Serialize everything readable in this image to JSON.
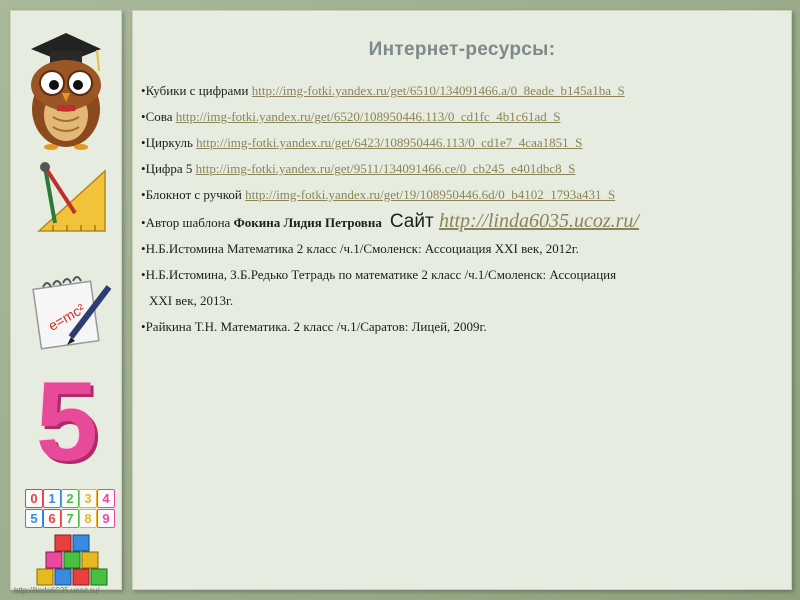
{
  "title": "Интернет-ресурсы:",
  "items": [
    {
      "label": "Кубики с цифрами ",
      "url": "http://img-fotki.yandex.ru/get/6510/134091466.a/0_8eade_b145a1ba_S"
    },
    {
      "label": "Сова ",
      "url": "http://img-fotki.yandex.ru/get/6520/108950446.113/0_cd1fc_4b1c61ad_S"
    },
    {
      "label": "Циркуль ",
      "url": "http://img-fotki.yandex.ru/get/6423/108950446.113/0_cd1e7_4caa1851_S"
    },
    {
      "label": "Цифра 5 ",
      "url": "http://img-fotki.yandex.ru/get/9511/134091466.ce/0_cb245_e401dbc8_S"
    },
    {
      "label": "Блокнот с ручкой ",
      "url": "http://img-fotki.yandex.ru/get/19/108950446.6d/0_b4102_1793a431_S"
    }
  ],
  "author": {
    "label": "Автор шаблона ",
    "name": "Фокина Лидия Петровна",
    "site_label": "Сайт ",
    "site_url": "http://linda6035.ucoz.ru/"
  },
  "references": [
    "Н.Б.Истомина Математика 2 класс /ч.1/Смоленск: Ассоциация XXI век, 2012г.",
    "Н.Б.Истомина, З.Б.Редько Тетрадь по математике 2 класс /ч.1/Смоленск: Ассоциация",
    "XXI век, 2013г.",
    "Райкина Т.Н. Математика. 2 класс /ч.1/Саратов: Лицей, 2009г."
  ],
  "footer": "http://linda6035.ucoz.ru/",
  "digits": [
    "0",
    "1",
    "2",
    "3",
    "4",
    "5",
    "6",
    "7",
    "8",
    "9"
  ],
  "big_digit": "5",
  "notebook_text": "e=mc²",
  "bullet": "•"
}
